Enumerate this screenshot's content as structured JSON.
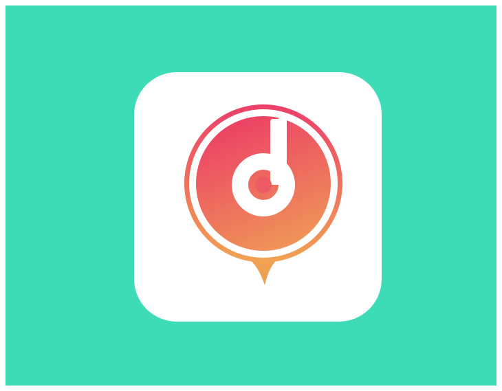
{
  "background_color": "#3edcb6",
  "tile_color": "#ffffff",
  "logo": {
    "icon": "music-note-pin-icon",
    "gradient_top": "#ec3f6a",
    "gradient_bottom": "#f1a352",
    "glyph_color": "#ffffff"
  }
}
